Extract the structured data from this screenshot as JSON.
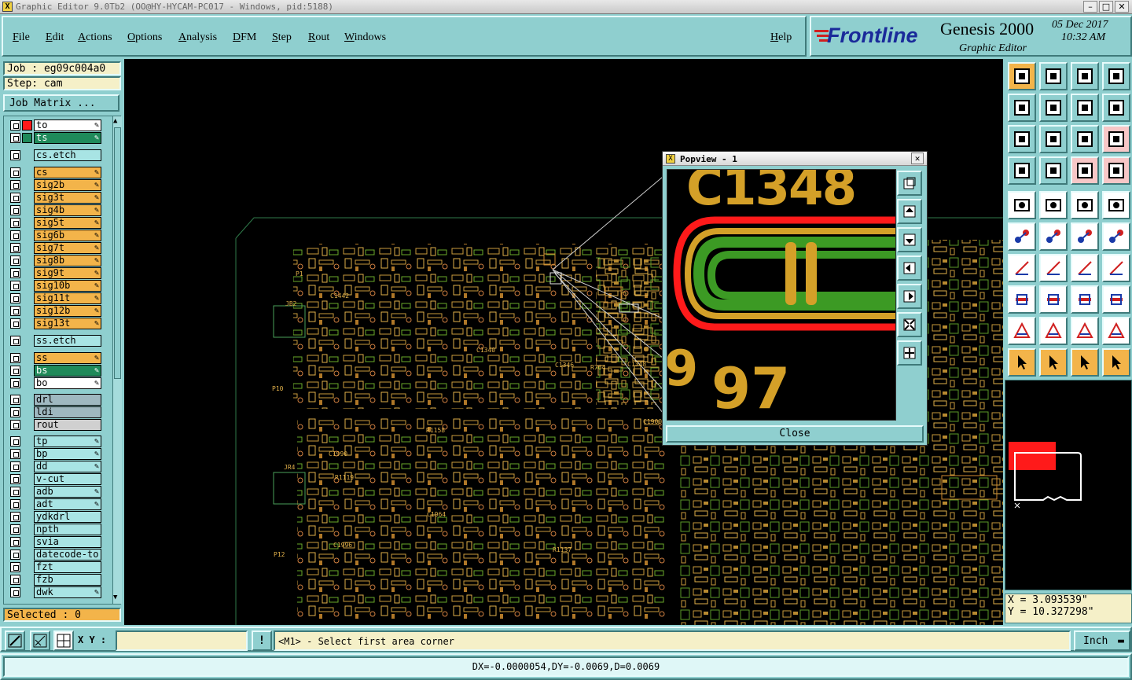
{
  "window": {
    "title": "Graphic Editor 9.0Tb2 (OO@HY-HYCAM-PC017 - Windows, pid:5188)",
    "min": "–",
    "max": "□",
    "close": "✕"
  },
  "menu": [
    "File",
    "Edit",
    "Actions",
    "Options",
    "Analysis",
    "DFM",
    "Step",
    "Rout",
    "Windows"
  ],
  "help": "Help",
  "brand": {
    "logo": "Frontline",
    "product": "Genesis 2000",
    "subtitle": "Graphic Editor",
    "date": "05 Dec 2017",
    "time": "10:32 AM"
  },
  "job": {
    "job_label": "Job : eg09c004a0",
    "step_label": "Step: cam",
    "matrix_btn": "Job Matrix ..."
  },
  "layers": [
    {
      "name": "to",
      "color": "#ffffff"
    },
    {
      "name": "ts",
      "color": "#1f8a5a"
    },
    {
      "name": "cs.etch",
      "color": "#a8e4e4"
    },
    {
      "name": "cs",
      "color": "#f3b44a"
    },
    {
      "name": "sig2b",
      "color": "#f3b44a"
    },
    {
      "name": "sig3t",
      "color": "#f3b44a"
    },
    {
      "name": "sig4b",
      "color": "#f3b44a"
    },
    {
      "name": "sig5t",
      "color": "#f3b44a"
    },
    {
      "name": "sig6b",
      "color": "#f3b44a"
    },
    {
      "name": "sig7t",
      "color": "#f3b44a"
    },
    {
      "name": "sig8b",
      "color": "#f3b44a"
    },
    {
      "name": "sig9t",
      "color": "#f3b44a"
    },
    {
      "name": "sig10b",
      "color": "#f3b44a"
    },
    {
      "name": "sig11t",
      "color": "#f3b44a"
    },
    {
      "name": "sig12b",
      "color": "#f3b44a"
    },
    {
      "name": "sig13t",
      "color": "#f3b44a"
    },
    {
      "name": "ss.etch",
      "color": "#a8e4e4"
    },
    {
      "name": "ss",
      "color": "#f3b44a"
    },
    {
      "name": "bs",
      "color": "#1f8a5a"
    },
    {
      "name": "bo",
      "color": "#ffffff"
    },
    {
      "name": "drl",
      "color": "#9fb8c0"
    },
    {
      "name": "ldi",
      "color": "#9fb8c0"
    },
    {
      "name": "rout",
      "color": "#d0d0d0"
    },
    {
      "name": "tp",
      "color": "#a8e4e4"
    },
    {
      "name": "bp",
      "color": "#a8e4e4"
    },
    {
      "name": "dd",
      "color": "#a8e4e4"
    },
    {
      "name": "v-cut",
      "color": "#a8e4e4"
    },
    {
      "name": "adb",
      "color": "#a8e4e4"
    },
    {
      "name": "adt",
      "color": "#a8e4e4"
    },
    {
      "name": "ydkdrl",
      "color": "#a8e4e4"
    },
    {
      "name": "npth",
      "color": "#a8e4e4"
    },
    {
      "name": "svia",
      "color": "#a8e4e4"
    },
    {
      "name": "datecode-to",
      "color": "#a8e4e4"
    },
    {
      "name": "fzt",
      "color": "#a8e4e4"
    },
    {
      "name": "fzb",
      "color": "#a8e4e4"
    },
    {
      "name": "dwk",
      "color": "#a8e4e4"
    }
  ],
  "selected": "Selected : 0",
  "popview": {
    "title": "Popview - 1",
    "close_btn": "Close",
    "label_top": "C1348",
    "label_bottom": "97",
    "label_side": "9"
  },
  "coords": {
    "x": "X = 3.093539\"",
    "y": "Y = 10.327298\""
  },
  "status": {
    "xy_label": "X Y :",
    "xy_value": "",
    "alert": "!",
    "message": "<M1> - Select first area corner",
    "units": "Inch"
  },
  "bottom": "DX=-0.0000054,DY=-0.0069,D=0.0069",
  "canvas_labels": [
    "P1",
    "JB2",
    "P10",
    "JR4",
    "P12",
    "C1442",
    "R1158",
    "C1346",
    "R764",
    "C1348",
    "C1900",
    "R1137",
    "C1340",
    "C1964",
    "C1990",
    "R1119",
    "C1996"
  ]
}
